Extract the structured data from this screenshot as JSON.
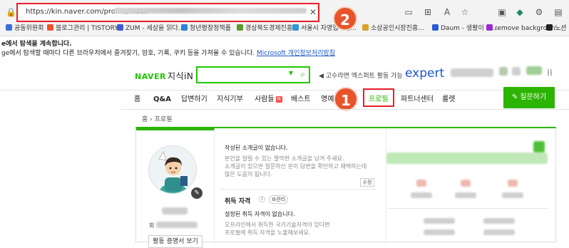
{
  "browser": {
    "url": "https://kin.naver.com/profile/index",
    "toolbar_icons": [
      "lock-icon",
      "tab-icon",
      "grid-icon",
      "read-aloud-icon",
      "favorite-icon",
      "sidebar-icon",
      "extension-icon",
      "settings-icon",
      "collections-icon",
      "profile-icon"
    ],
    "bookmarks": [
      {
        "label": "공동위원회",
        "color": "#3b6fd8"
      },
      {
        "label": "블로그관리 | TISTORY",
        "color": "#f0532a"
      },
      {
        "label": "ZUM - 세상을 읽다...",
        "color": "#3b5bd8"
      },
      {
        "label": "청년평창정책플",
        "color": "#2a84d8"
      },
      {
        "label": "경상북도경제진흥원",
        "color": "#5a9a2a"
      },
      {
        "label": "서울시 자영업지원...",
        "color": "#2a9ad8"
      },
      {
        "label": "소상공인시장진흥...",
        "color": "#d8a22a"
      },
      {
        "label": "Daum - 생활이 바...",
        "color": "#2a5ad8"
      },
      {
        "label": "remove backgroun...",
        "color": "#9a2ad8"
      },
      {
        "label": "노션",
        "color": "#222222"
      }
    ]
  },
  "infobar": {
    "line1": "e에서 탐색을 계속합니다.",
    "line2": "ge에서 탐색할 때마다 다른 브라우저에서 즐겨찾기, 암호, 기록, 쿠키 등을 가져올 수 있습니다.",
    "link": "Microsoft 개인정보처리방침"
  },
  "header": {
    "logo": "NAVER",
    "service": "지식iN",
    "promo": "◀ 고수라면 엑스퍼트 활동 가능",
    "expert": "expert"
  },
  "nav": {
    "items": [
      "홈",
      "Q&A",
      "답변하기",
      "지식기부",
      "사람들",
      "베스트",
      "명예",
      "프로필",
      "파트너센터",
      "룰렛"
    ],
    "new_badge": "N",
    "question_button": "질문하기"
  },
  "breadcrumb": "홈 › 프로필",
  "profile": {
    "name_prefix": "회",
    "cert_button": "활동 증명서 보기",
    "intro_title": "작성된 소개글이 없습니다.",
    "intro_lines": [
      "본인을 알릴 수 있는 짤막한 소개글을 남겨 주세요.",
      "소개글이 있으면 질문하신 분이 답변을 확인하고 채택하는데",
      "많은 도움이 됩니다."
    ],
    "modify_button": "수정",
    "qual_title": "취득 자격",
    "qual_info": "i",
    "qual_manage": "⚙관리",
    "qual_empty": "설정된 취득 자격이 없습니다.",
    "qual_lines": [
      "오프라인에서 취득한 국가기술자격이 있다면",
      "프로필에 취득 자격을 노출해보세요."
    ]
  },
  "annotations": {
    "step1": "1",
    "step2": "2",
    "highlight_color": "#e8202a",
    "circle_color": "#e8532a"
  },
  "colors": {
    "naver_green": "#2db400",
    "expert_blue": "#1b54d4"
  }
}
